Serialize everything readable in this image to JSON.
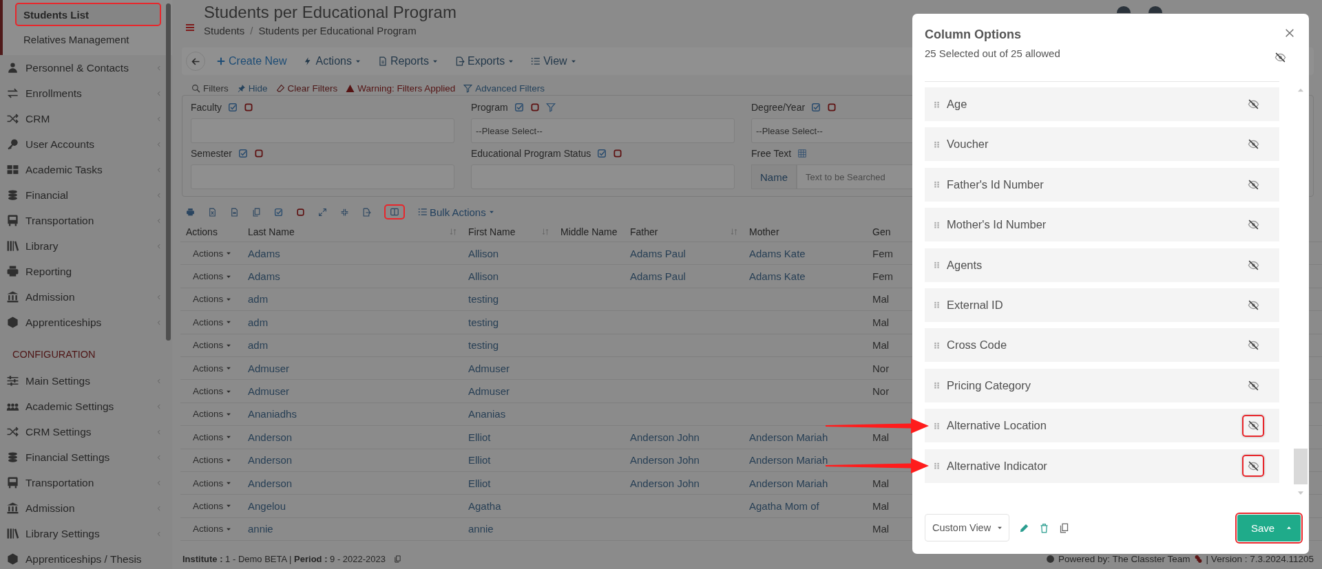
{
  "sidebar": {
    "submenu": [
      {
        "label": "Students List",
        "selected": true,
        "highlighted": true
      },
      {
        "label": "Relatives Management",
        "selected": false,
        "highlighted": false
      }
    ],
    "items": [
      {
        "label": "Personnel & Contacts",
        "expandable": true
      },
      {
        "label": "Enrollments",
        "expandable": true
      },
      {
        "label": "CRM",
        "expandable": true
      },
      {
        "label": "User Accounts",
        "expandable": true
      },
      {
        "label": "Academic Tasks",
        "expandable": true
      },
      {
        "label": "Financial",
        "expandable": true
      },
      {
        "label": "Transportation",
        "expandable": true
      },
      {
        "label": "Library",
        "expandable": true
      },
      {
        "label": "Reporting",
        "expandable": false
      },
      {
        "label": "Admission",
        "expandable": true
      },
      {
        "label": "Apprenticeships",
        "expandable": true
      }
    ],
    "section_heading": "CONFIGURATION",
    "config_items": [
      {
        "label": "Main Settings",
        "expandable": true
      },
      {
        "label": "Academic Settings",
        "expandable": true
      },
      {
        "label": "CRM Settings",
        "expandable": true
      },
      {
        "label": "Financial Settings",
        "expandable": true
      },
      {
        "label": "Transportation",
        "expandable": true
      },
      {
        "label": "Admission",
        "expandable": true
      },
      {
        "label": "Library Settings",
        "expandable": true
      },
      {
        "label": "Apprenticeships / Thesis",
        "expandable": false
      }
    ]
  },
  "page": {
    "title": "Students per Educational Program",
    "breadcrumb": [
      "Students",
      "Students per Educational Program"
    ],
    "breadcrumb_separator": "/"
  },
  "toolbar": [
    {
      "label": "Create New",
      "dropdown": false
    },
    {
      "label": "Actions",
      "dropdown": true
    },
    {
      "label": "Reports",
      "dropdown": true
    },
    {
      "label": "Exports",
      "dropdown": true
    },
    {
      "label": "View",
      "dropdown": true
    }
  ],
  "filters": {
    "links": [
      {
        "label": "Filters",
        "kind": "plain"
      },
      {
        "label": "Hide",
        "kind": "link"
      },
      {
        "label": "Clear Filters",
        "kind": "danger"
      },
      {
        "label": "Warning: Filters Applied",
        "kind": "warning"
      },
      {
        "label": "Advanced Filters",
        "kind": "link"
      }
    ],
    "fields": [
      {
        "label": "Faculty",
        "kind": "text",
        "funnel": false
      },
      {
        "label": "Program",
        "kind": "select",
        "placeholder": "--Please Select--",
        "funnel": true
      },
      {
        "label": "Degree/Year",
        "kind": "select",
        "placeholder": "--Please Select--",
        "funnel": false
      },
      {
        "label": "Semester",
        "kind": "text",
        "funnel": false
      },
      {
        "label": "Educational Program Status",
        "kind": "text",
        "funnel": false
      },
      {
        "label": "Free Text",
        "kind": "search",
        "addon": "Name",
        "placeholder": "Text to be Searched",
        "funnel": false
      }
    ]
  },
  "table_toolbar": {
    "columns_button_highlighted": true,
    "bulk_actions": "Bulk Actions"
  },
  "table": {
    "columns": [
      {
        "label": "Actions",
        "sortable": false
      },
      {
        "label": "Last Name",
        "sortable": true
      },
      {
        "label": "First Name",
        "sortable": true
      },
      {
        "label": "Middle Name",
        "sortable": false
      },
      {
        "label": "Father",
        "sortable": true
      },
      {
        "label": "Mother",
        "sortable": false
      },
      {
        "label": "Gen",
        "sortable": false
      }
    ],
    "rows": [
      {
        "actions": "Actions",
        "last_name": "Adams",
        "first_name": "Allison",
        "father": "Adams Paul",
        "mother": "Adams Kate",
        "column_7": "Fem"
      },
      {
        "actions": "Actions",
        "last_name": "Adams",
        "first_name": "Allison",
        "father": "Adams Paul",
        "mother": "Adams Kate",
        "column_7": "Fem"
      },
      {
        "actions": "Actions",
        "last_name": "adm",
        "first_name": "testing",
        "column_7": "Mal"
      },
      {
        "actions": "Actions",
        "last_name": "adm",
        "first_name": "testing",
        "column_7": "Mal"
      },
      {
        "actions": "Actions",
        "last_name": "adm",
        "first_name": "testing",
        "column_7": "Mal"
      },
      {
        "actions": "Actions",
        "last_name": "Admuser",
        "first_name": "Admuser",
        "column_7": "Nor"
      },
      {
        "actions": "Actions",
        "last_name": "Admuser",
        "first_name": "Admuser",
        "column_7": "Nor"
      },
      {
        "actions": "Actions",
        "last_name": "Ananiadhs",
        "first_name": "Ananias"
      },
      {
        "actions": "Actions",
        "last_name": "Anderson",
        "first_name": "Elliot",
        "father": "Anderson John",
        "mother": "Anderson Mariah",
        "column_7": "Mal"
      },
      {
        "actions": "Actions",
        "last_name": "Anderson",
        "first_name": "Elliot",
        "father": "Anderson John",
        "mother": "Anderson Mariah"
      },
      {
        "actions": "Actions",
        "last_name": "Anderson",
        "first_name": "Elliot",
        "father": "Anderson John",
        "mother": "Anderson Mariah",
        "column_7": "Mal"
      },
      {
        "actions": "Actions",
        "last_name": "Angelou",
        "first_name": "Agatha",
        "mother": "Agatha Mom of",
        "column_7": "Mal"
      },
      {
        "actions": "Actions",
        "last_name": "annie",
        "first_name": "annie",
        "column_7": "Mal"
      }
    ]
  },
  "footer": {
    "context": "**Institute :** 1 - Demo BETA | **Period :** 9 - 2022-2023",
    "powered_by": "Powered by: The Classter Team",
    "version": "| Version : 7.3.2024.11205"
  },
  "modal": {
    "title": "Column Options",
    "subtitle": "25 Selected out of 25 allowed",
    "columns": [
      {
        "label": "Age",
        "highlighted": false
      },
      {
        "label": "Voucher",
        "highlighted": false
      },
      {
        "label": "Father's Id Number",
        "highlighted": false
      },
      {
        "label": "Mother's Id Number",
        "highlighted": false
      },
      {
        "label": "Agents",
        "highlighted": false
      },
      {
        "label": "External ID",
        "highlighted": false
      },
      {
        "label": "Cross Code",
        "highlighted": false
      },
      {
        "label": "Pricing Category",
        "highlighted": false
      },
      {
        "label": "Alternative Location",
        "highlighted": true
      },
      {
        "label": "Alternative Indicator",
        "highlighted": true
      }
    ],
    "view_select": "Custom View",
    "save": "Save",
    "save_highlighted": true
  }
}
